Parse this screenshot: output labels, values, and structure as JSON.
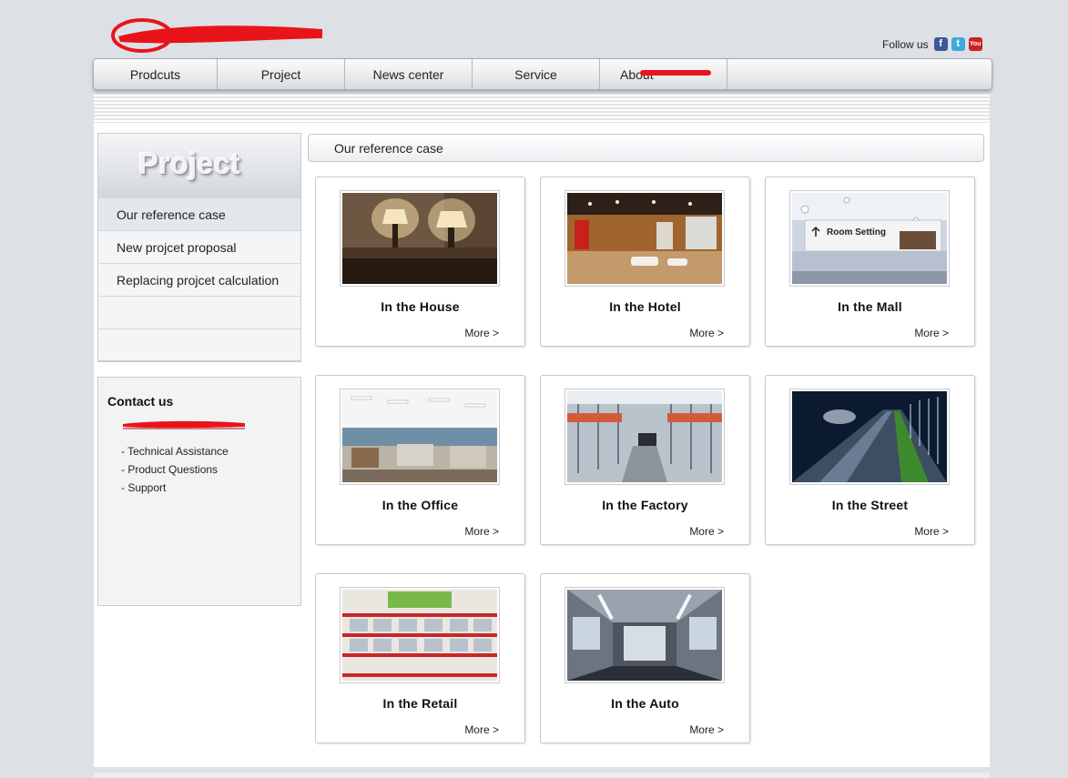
{
  "header": {
    "follow_label": "Follow us",
    "social": [
      {
        "name": "facebook-icon",
        "glyph": "f"
      },
      {
        "name": "twitter-icon",
        "glyph": "t"
      },
      {
        "name": "youtube-icon",
        "glyph": "You"
      }
    ]
  },
  "nav": [
    {
      "label": "Prodcuts"
    },
    {
      "label": "Project"
    },
    {
      "label": "News center"
    },
    {
      "label": "Service"
    },
    {
      "label": "About"
    }
  ],
  "sidebar": {
    "title": "Project",
    "items": [
      {
        "label": "Our reference case",
        "active": true
      },
      {
        "label": "New projcet proposal"
      },
      {
        "label": "Replacing projcet calculation"
      },
      {
        "label": ""
      },
      {
        "label": ""
      }
    ]
  },
  "contact": {
    "title": "Contact us",
    "links": [
      "- Technical Assistance",
      "- Product Questions",
      "- Support"
    ]
  },
  "content": {
    "heading": "Our reference case",
    "more_label": "More >",
    "cards": [
      {
        "title": "In the House",
        "scene": "house"
      },
      {
        "title": "In the Hotel",
        "scene": "hotel"
      },
      {
        "title": "In the Mall",
        "scene": "mall",
        "photo_text": "Room Setting"
      },
      {
        "title": "In the Office",
        "scene": "office"
      },
      {
        "title": "In the Factory",
        "scene": "factory"
      },
      {
        "title": "In the Street",
        "scene": "street"
      },
      {
        "title": "In the Retail",
        "scene": "retail"
      },
      {
        "title": "In the Auto",
        "scene": "auto"
      }
    ]
  },
  "colors": {
    "page_bg": "#dde1e6",
    "redaction": "#e8141a"
  }
}
